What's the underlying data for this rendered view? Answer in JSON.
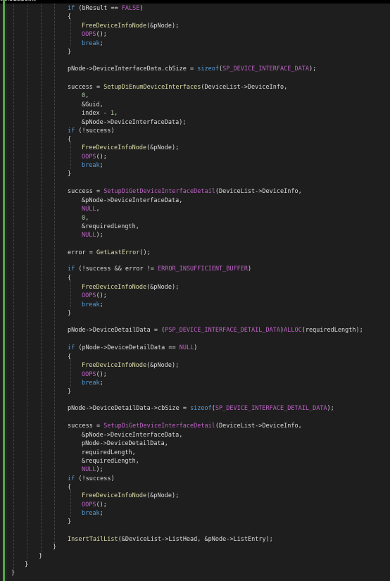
{
  "window": {
    "title_fragment": "ttcledusoint"
  },
  "colors": {
    "background": "#1e1e1e",
    "change_bar": "#57a64a",
    "keyword": "#569cd6",
    "macro": "#bd63c5",
    "function": "#dcdcaa",
    "number": "#b5cea8",
    "text": "#dcdcdc"
  },
  "code_lines": [
    "if (bResult == FALSE)",
    "{",
    "FreeDeviceInfoNode(&pNode);",
    "OOPS();",
    "break;",
    "}",
    "pNode->DeviceInterfaceData.cbSize = sizeof(SP_DEVICE_INTERFACE_DATA);",
    "success = SetupDiEnumDeviceInterfaces(DeviceList->DeviceInfo,",
    "0,",
    "&Guid,",
    "index - 1,",
    "&pNode->DeviceInterfaceData);",
    "if (!success)",
    "{",
    "FreeDeviceInfoNode(&pNode);",
    "OOPS();",
    "break;",
    "}",
    "success = SetupDiGetDeviceInterfaceDetail(DeviceList->DeviceInfo,",
    "&pNode->DeviceInterfaceData,",
    "NULL,",
    "0,",
    "&requiredLength,",
    "NULL);",
    "error = GetLastError();",
    "if (!success && error != ERROR_INSUFFICIENT_BUFFER)",
    "{",
    "FreeDeviceInfoNode(&pNode);",
    "OOPS();",
    "break;",
    "}",
    "pNode->DeviceDetailData = (PSP_DEVICE_INTERFACE_DETAIL_DATA)ALLOC(requiredLength);",
    "if (pNode->DeviceDetailData == NULL)",
    "{",
    "FreeDeviceInfoNode(&pNode);",
    "OOPS();",
    "break;",
    "}",
    "pNode->DeviceDetailData->cbSize = sizeof(SP_DEVICE_INTERFACE_DETAIL_DATA);",
    "success = SetupDiGetDeviceInterfaceDetail(DeviceList->DeviceInfo,",
    "&pNode->DeviceInterfaceData,",
    "pNode->DeviceDetailData,",
    "requiredLength,",
    "&requiredLength,",
    "NULL);",
    "if (!success)",
    "{",
    "FreeDeviceInfoNode(&pNode);",
    "OOPS();",
    "break;",
    "}",
    "InsertTailList(&DeviceList->ListHead, &pNode->ListEntry);",
    "}",
    "}",
    "}",
    "}"
  ]
}
